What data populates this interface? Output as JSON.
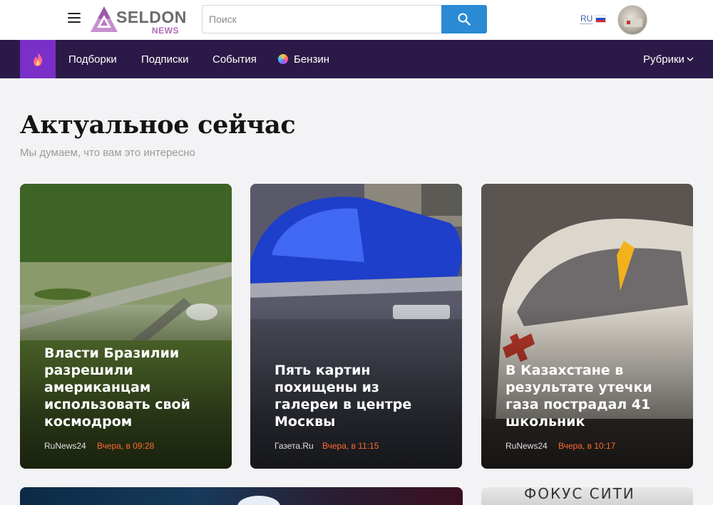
{
  "header": {
    "logo_title": "SELDON",
    "logo_sub": "NEWS",
    "search_placeholder": "Поиск",
    "lang": "RU"
  },
  "nav": {
    "items": [
      "Подборки",
      "Подписки",
      "События",
      "Бензин"
    ],
    "rubrics": "Рубрики"
  },
  "main": {
    "title": "Актуальное сейчас",
    "subtitle": "Мы думаем, что вам это интересно"
  },
  "cards": [
    {
      "title": "Власти Бразилии разрешили американцам использовать свой космодром",
      "source": "RuNews24",
      "time": "Вчера, в 09:28"
    },
    {
      "title": "Пять картин похищены из галереи в центре Москвы",
      "source": "Газета.Ru",
      "time": "Вчера, в 11:15"
    },
    {
      "title": "В Казахстане в результате утечки газа пострадал 41 школьник",
      "source": "RuNews24",
      "time": "Вчера, в 10:17"
    }
  ],
  "next_row": {
    "partial_text": "ФОКУС СИТИ"
  }
}
